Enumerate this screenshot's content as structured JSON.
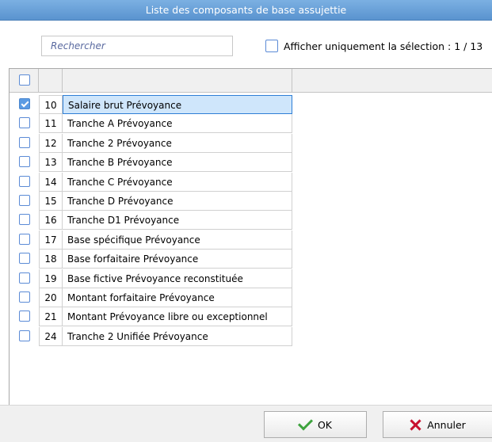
{
  "window": {
    "title": "Liste des composants de base assujettie"
  },
  "search": {
    "placeholder": "Rechercher"
  },
  "filter": {
    "show_selected_label": "Afficher uniquement la sélection : 1 / 13",
    "checked": false
  },
  "table": {
    "header_checkbox_checked": false,
    "rows": [
      {
        "num": "10",
        "label": "Salaire brut Prévoyance",
        "checked": true,
        "selected": true
      },
      {
        "num": "11",
        "label": "Tranche A Prévoyance",
        "checked": false
      },
      {
        "num": "12",
        "label": "Tranche 2 Prévoyance",
        "checked": false
      },
      {
        "num": "13",
        "label": "Tranche B Prévoyance",
        "checked": false
      },
      {
        "num": "14",
        "label": "Tranche C Prévoyance",
        "checked": false
      },
      {
        "num": "15",
        "label": "Tranche D Prévoyance",
        "checked": false
      },
      {
        "num": "16",
        "label": "Tranche D1 Prévoyance",
        "checked": false
      },
      {
        "num": "17",
        "label": "Base spécifique Prévoyance",
        "checked": false
      },
      {
        "num": "18",
        "label": "Base forfaitaire Prévoyance",
        "checked": false
      },
      {
        "num": "19",
        "label": "Base fictive Prévoyance reconstituée",
        "checked": false
      },
      {
        "num": "20",
        "label": "Montant forfaitaire Prévoyance",
        "checked": false
      },
      {
        "num": "21",
        "label": "Montant Prévoyance libre ou exceptionnel",
        "checked": false
      },
      {
        "num": "24",
        "label": "Tranche 2 Unifiée Prévoyance",
        "checked": false
      }
    ]
  },
  "buttons": {
    "ok_label": "OK",
    "cancel_label": "Annuler"
  },
  "icons": {
    "ok": "check-icon",
    "cancel": "close-icon"
  },
  "colors": {
    "title_bar": "#6aa3da",
    "ok_check": "#3ea33e",
    "cancel_x": "#c8102e",
    "selection": "#cfe6fb"
  }
}
